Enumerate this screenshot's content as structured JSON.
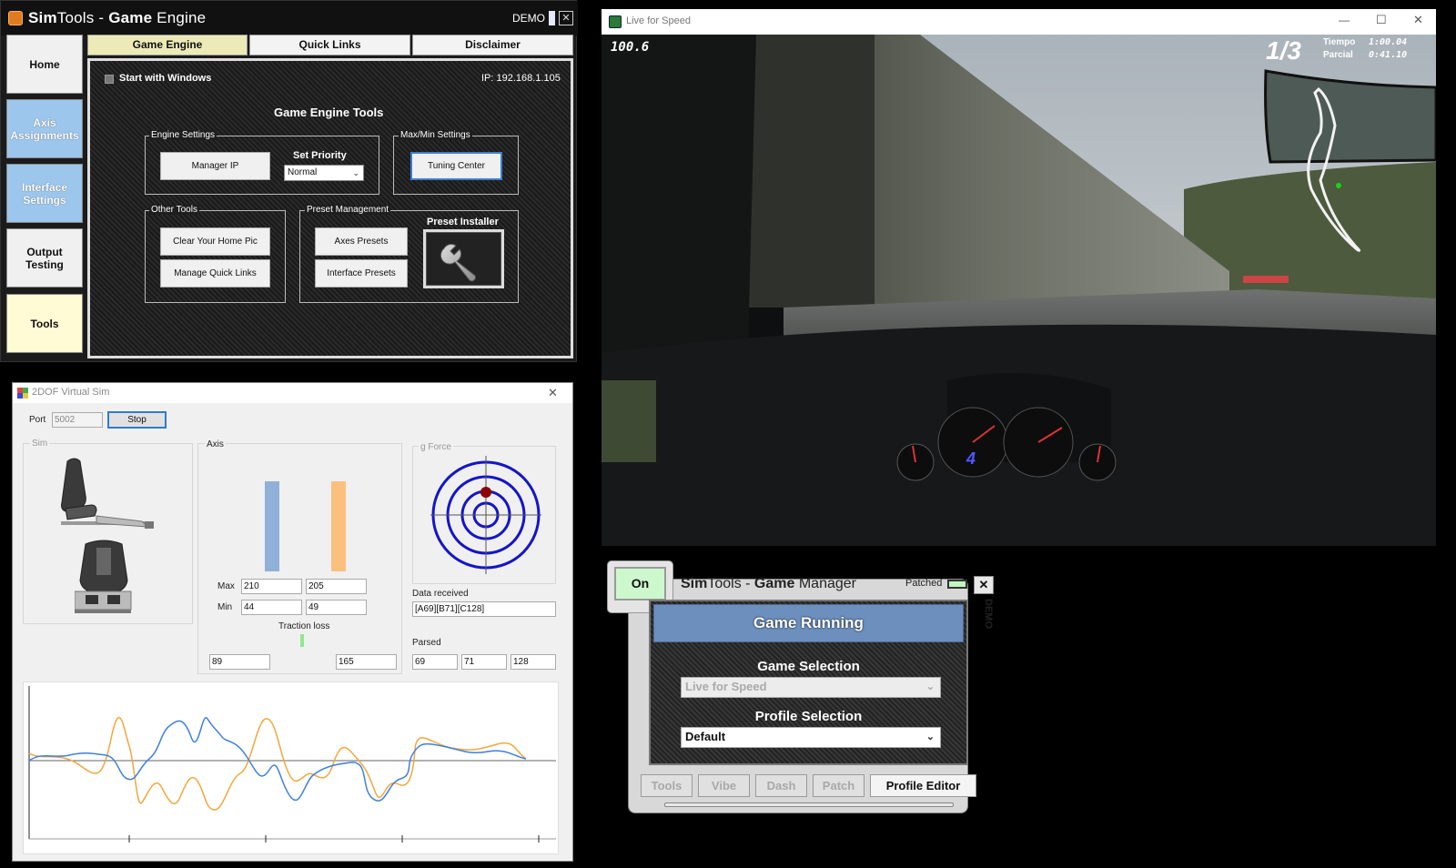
{
  "game_engine": {
    "title_bold_1": "Sim",
    "title_light": "Tools - ",
    "title_bold_2": "Game",
    "title_rest": " Engine",
    "demo_label": "DEMO",
    "close_glyph": "✕",
    "nav": [
      {
        "label": "Home"
      },
      {
        "label": "Axis Assignments"
      },
      {
        "label": "Interface Settings"
      },
      {
        "label": "Output Testing"
      },
      {
        "label": "Tools"
      }
    ],
    "tabs": [
      {
        "label": "Game Engine"
      },
      {
        "label": "Quick Links"
      },
      {
        "label": "Disclaimer"
      }
    ],
    "start_with_windows": "Start with Windows",
    "ip": "IP: 192.168.1.105",
    "tools_heading": "Game Engine Tools",
    "engine_settings": {
      "label": "Engine Settings",
      "manager_ip_button": "Manager IP",
      "set_priority_label": "Set Priority",
      "priority_value": "Normal"
    },
    "maxmin_settings": {
      "label": "Max/Min Settings",
      "tuning_center_button": "Tuning Center"
    },
    "other_tools": {
      "label": "Other Tools",
      "clear_home_pic_button": "Clear Your Home Pic",
      "manage_quick_links_button": "Manage Quick Links"
    },
    "preset_management": {
      "label": "Preset Management",
      "axes_presets_button": "Axes Presets",
      "interface_presets_button": "Interface Presets",
      "preset_installer_label": "Preset Installer"
    }
  },
  "virtual_sim": {
    "title": "2DOF Virtual Sim",
    "close_glyph": "✕",
    "port_label": "Port",
    "port_value": "5002",
    "stop_button": "Stop",
    "sim_label": "Sim",
    "axis_label": "Axis",
    "gforce_label": "g Force",
    "max_label": "Max",
    "min_label": "Min",
    "max_values": [
      "210",
      "205"
    ],
    "min_values": [
      "44",
      "49"
    ],
    "traction_loss_label": "Traction loss",
    "axis_values": [
      "89",
      "165"
    ],
    "data_received_label": "Data received",
    "data_received_value": "[A69][B71][C128]",
    "parsed_label": "Parsed",
    "parsed_values": [
      "69",
      "71",
      "128"
    ],
    "colors": {
      "axis1": "#90b0d8",
      "axis2": "#fcc07e",
      "series_blue": "#3f7fe0",
      "series_orange": "#f3a73a",
      "target": "#1515c8",
      "dot": "#8b0000",
      "traction": "#8ee88e"
    }
  },
  "live_for_speed": {
    "title": "Live for Speed",
    "minimize_glyph": "—",
    "maximize_glyph": "☐",
    "close_glyph": "✕",
    "hud_speed": "100.6",
    "hud_lap": "1/3",
    "hud_time_label": "Tiempo",
    "hud_time_value": "1:00.04",
    "hud_split_label": "Parcial",
    "hud_split_value": "0:41.10",
    "gear": "4"
  },
  "game_manager": {
    "on_button": "On",
    "title_bold_1": "Sim",
    "title_light": "Tools - ",
    "title_bold_2": "Game",
    "title_rest": " Manager",
    "patched_label": "Patched",
    "close_glyph": "✕",
    "demo_vertical": "DEMO",
    "status": "Game Running",
    "game_selection_label": "Game Selection",
    "game_selection_value": "Live for Speed",
    "profile_selection_label": "Profile Selection",
    "profile_selection_value": "Default",
    "tabs": [
      "Tools",
      "Vibe",
      "Dash",
      "Patch",
      "Profile Editor"
    ]
  }
}
